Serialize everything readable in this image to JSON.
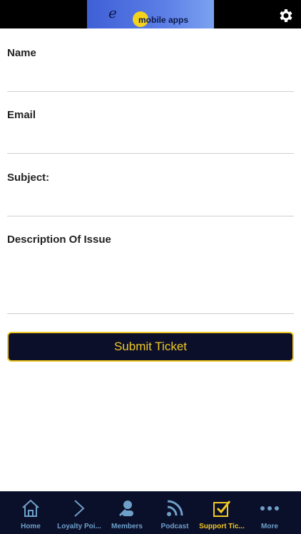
{
  "header": {
    "logo_letter": "e",
    "logo_text": "mobile apps",
    "settings_icon": "gear-icon"
  },
  "form": {
    "name_label": "Name",
    "name_value": "",
    "email_label": "Email",
    "email_value": "",
    "subject_label": "Subject:",
    "subject_value": "",
    "description_label": "Description Of Issue",
    "description_value": "",
    "submit_label": "Submit Ticket"
  },
  "tabs": [
    {
      "label": "Home",
      "icon": "home-icon"
    },
    {
      "label": "Loyalty Poi...",
      "icon": "chevron-right-icon"
    },
    {
      "label": "Members",
      "icon": "members-icon"
    },
    {
      "label": "Podcast",
      "icon": "rss-icon"
    },
    {
      "label": "Support Tic...",
      "icon": "checkbox-icon",
      "active": true
    },
    {
      "label": "More",
      "icon": "more-icon"
    }
  ],
  "colors": {
    "accent": "#f3c923",
    "tab_inactive": "#6fa0c9",
    "navy": "#0b0f2a"
  }
}
